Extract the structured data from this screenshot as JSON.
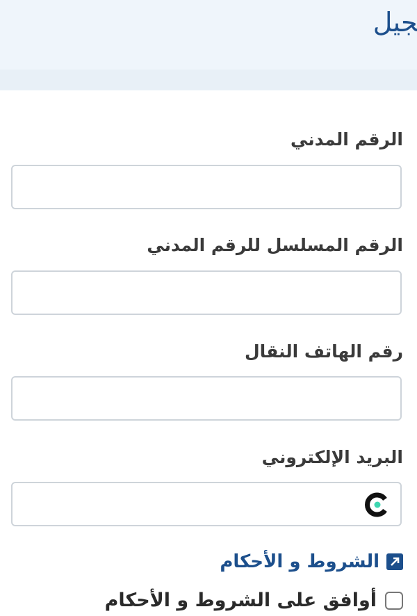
{
  "header": {
    "title": "تسجيل"
  },
  "form": {
    "civil_id_label": "الرقم المدني",
    "civil_id_serial_label": "الرقم المسلسل للرقم المدني",
    "mobile_label": "رقم الهاتف النقال",
    "email_label": "البريد الإلكتروني",
    "civil_id_value": "",
    "civil_id_serial_value": "",
    "mobile_value": "",
    "email_value": ""
  },
  "terms": {
    "link_label": "الشروط و الأحكام",
    "agree_label": "أوافق على الشروط و الأحكام",
    "agree_checked": false
  },
  "icons": {
    "external_link": "external-link-icon",
    "autofill": "password-manager-icon"
  },
  "colors": {
    "accent": "#1c4f8c",
    "header_bg": "#eff5fb",
    "autofill_dot": "#3ed6b0"
  }
}
